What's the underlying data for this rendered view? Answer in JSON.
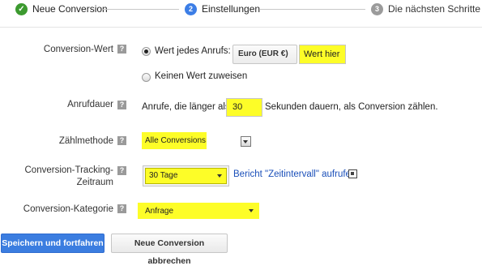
{
  "stepper": {
    "steps": [
      {
        "number": "",
        "label": "Neue Conversion",
        "state": "done",
        "icon": "checkmark-icon"
      },
      {
        "number": "2",
        "label": "Einstellungen",
        "state": "active"
      },
      {
        "number": "3",
        "label": "Die nächsten Schritte",
        "state": "pending"
      }
    ],
    "colors": {
      "done": "#3c9a2f",
      "active": "#3c7ee6",
      "pending": "#9b9b9b"
    }
  },
  "form": {
    "help_glyph": "?",
    "conversion_value": {
      "label": "Conversion-Wert",
      "option_each_call": "Wert jedes Anrufs:",
      "currency": "Euro (EUR €)",
      "value_input": "Wert hier",
      "option_no_value": "Keinen Wert zuweisen",
      "selected": "each_call"
    },
    "call_duration": {
      "label": "Anrufdauer",
      "text_before": "Anrufe, die länger als",
      "seconds_value": "30",
      "text_after": "Sekunden dauern, als Conversion zählen."
    },
    "counting_method": {
      "label": "Zählmethode",
      "value": "Alle Conversions"
    },
    "tracking_period": {
      "label_line1": "Conversion-Tracking-",
      "label_line2": "Zeitraum",
      "value": "30 Tage",
      "report_link": "Bericht \"Zeitintervall\" aufrufen"
    },
    "category": {
      "label": "Conversion-Kategorie",
      "value": "Anfrage"
    }
  },
  "actions": {
    "save": "Speichern und fortfahren",
    "cancel": "Neue Conversion abbrechen"
  },
  "colors": {
    "highlight": "#fdfd28",
    "primary_button": "#3b7de0",
    "link": "#1a4fb9"
  }
}
